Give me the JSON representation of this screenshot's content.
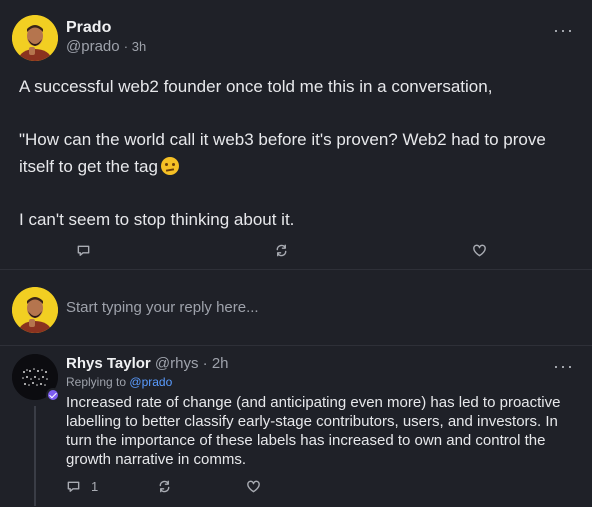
{
  "post": {
    "author": "Prado",
    "handle": "@prado",
    "separator": "·",
    "time": "3h",
    "more_label": "···",
    "body": {
      "line1": "A successful web2 founder once told me this in a conversation,",
      "line2": "\"How can the world call it web3 before it's proven? Web2 had to prove itself to get the tag",
      "emoji": "thinking-face-emoji",
      "line3": "I can't seem to stop thinking about it."
    },
    "actions": {
      "comment_icon": "comment-icon",
      "recast_icon": "recast-icon",
      "like_icon": "heart-icon"
    }
  },
  "reply_box": {
    "placeholder": "Start typing your reply here..."
  },
  "comment": {
    "author": "Rhys Taylor",
    "handle": "@rhys",
    "separator": "·",
    "time": "2h",
    "more_label": "···",
    "replying_prefix": "Replying to",
    "replying_to": "@prado",
    "body": "Increased rate of change (and anticipating even more) has led to proactive labelling to better classify early-stage contributors, users, and investors. In turn the importance of these labels has increased to own and control the growth narrative in comms.",
    "actions": {
      "comment_count": "1",
      "comment_icon": "comment-icon",
      "recast_icon": "recast-icon",
      "like_icon": "heart-icon"
    }
  },
  "colors": {
    "background": "#1f2128",
    "avatar_yellow": "#f2cf22",
    "link_blue": "#5a9cff",
    "badge_purple": "#7d5df0"
  }
}
